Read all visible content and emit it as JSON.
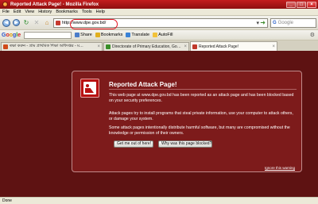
{
  "window": {
    "title": "Reported Attack Page! - Mozilla Firefox"
  },
  "menu": [
    "File",
    "Edit",
    "View",
    "History",
    "Bookmarks",
    "Tools",
    "Help"
  ],
  "nav": {
    "url": "http://www.dpe.gov.bd/",
    "search_placeholder": "Google"
  },
  "google_toolbar": {
    "share_label": "Share",
    "bookmarks_label": "Bookmarks",
    "translate_label": "Translate",
    "autofill_label": "AutoFill"
  },
  "tabs": [
    {
      "label": "ৰক্ষা করুন - গ্রাম প্রাথমিক শিক্ষা অধিদপ্তর - ম…",
      "color": "#d04a1a"
    },
    {
      "label": "Directorate of Primary Education, Gove…",
      "color": "#3a8f2a"
    },
    {
      "label": "Reported Attack Page!",
      "color": "#c0392b"
    }
  ],
  "dialog": {
    "title": "Reported Attack Page!",
    "p1": "This web page at www.dpe.gov.bd has been reported as an attack page and has been blocked based on your security preferences.",
    "p2": "Attack pages try to install programs that steal private information, use your computer to attack others, or damage your system.",
    "p3": "Some attack pages intentionally distribute harmful software, but many are compromised without the knowledge or permission of their owners.",
    "get_out_label": "Get me out of here!",
    "why_label": "Why was this page blocked?",
    "ignore_label": "Ignore this warning"
  },
  "status": {
    "text": "Done"
  }
}
